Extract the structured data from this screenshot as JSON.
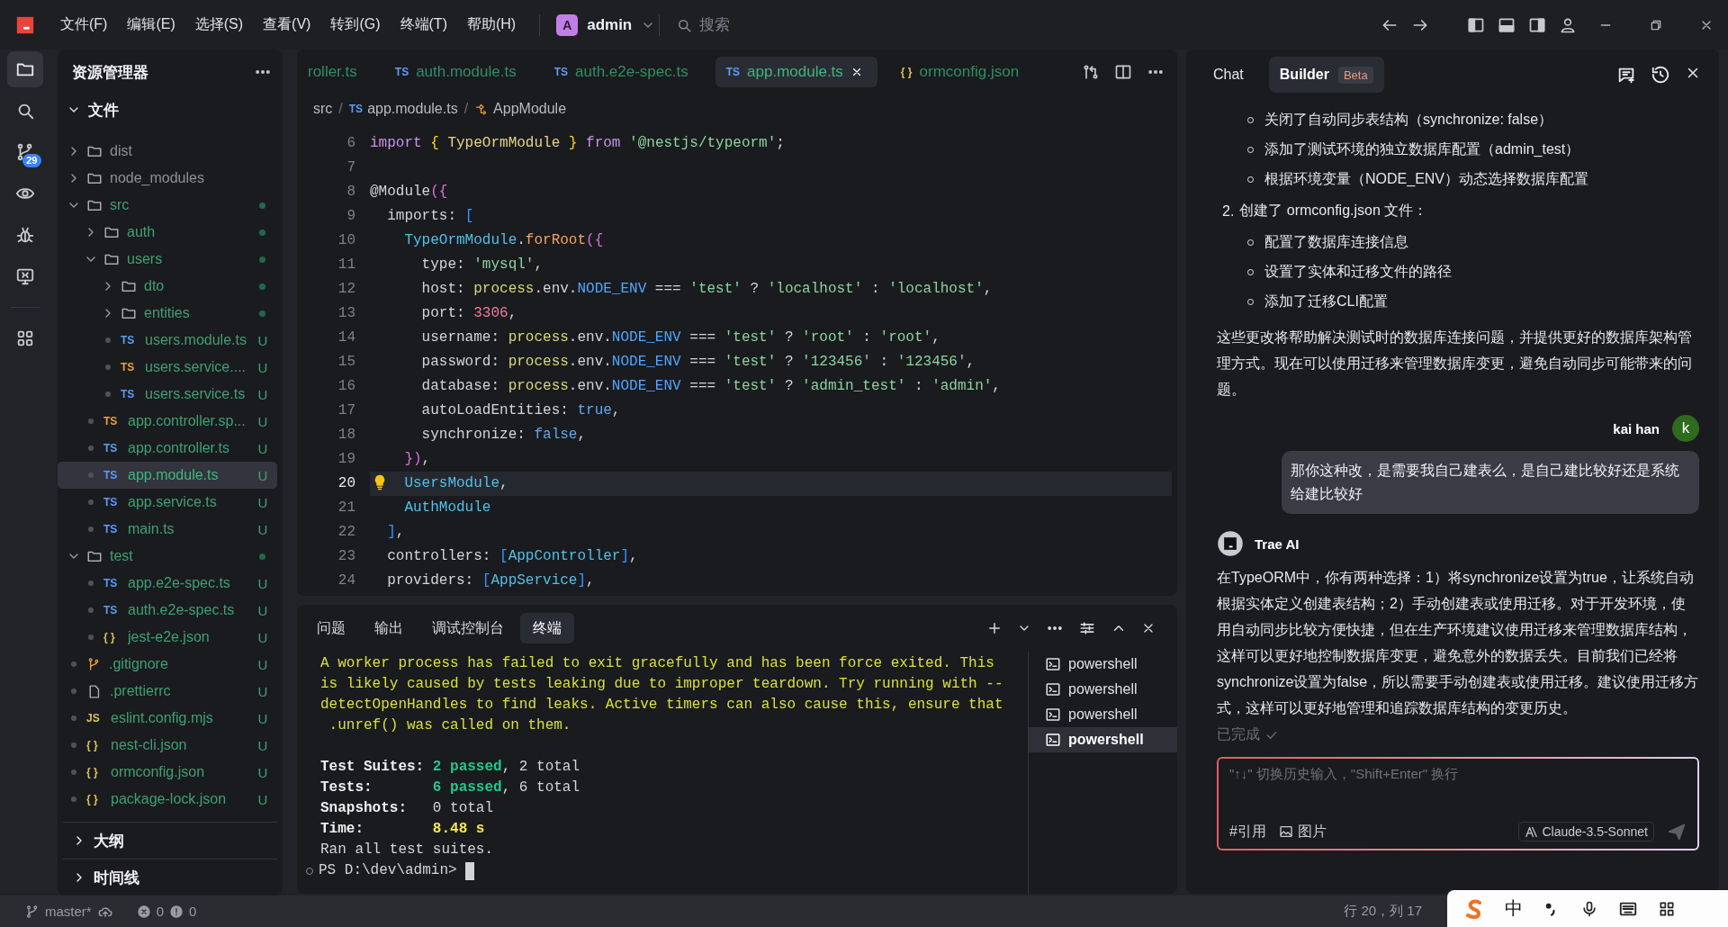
{
  "title_bar": {
    "menus": [
      "文件(F)",
      "编辑(E)",
      "选择(S)",
      "查看(V)",
      "转到(G)",
      "终端(T)",
      "帮助(H)"
    ],
    "account": {
      "initial": "A",
      "name": "admin"
    },
    "search": {
      "placeholder": "搜索"
    }
  },
  "activity_bar": {
    "items": [
      {
        "kind": "explorer",
        "selected": true
      },
      {
        "kind": "search",
        "selected": false
      },
      {
        "kind": "source_control",
        "selected": false,
        "badge": "29"
      },
      {
        "kind": "remote",
        "selected": false
      },
      {
        "kind": "debug",
        "selected": false
      },
      {
        "kind": "remote_explorer",
        "selected": false
      },
      {
        "kind": "extensions",
        "selected": false
      }
    ]
  },
  "sidebar": {
    "title": "资源管理器",
    "section": {
      "label": "文件",
      "expanded": true
    },
    "tree": [
      {
        "name": "dist",
        "kind": "folder",
        "expanded": false,
        "untracked": false,
        "changed": false,
        "selected": false
      },
      {
        "name": "node_modules",
        "kind": "folder",
        "expanded": false,
        "untracked": false,
        "changed": false,
        "selected": false
      },
      {
        "name": "src",
        "kind": "folder",
        "expanded": true,
        "untracked": true,
        "changed": true,
        "selected": false,
        "children": [
          {
            "name": "auth",
            "kind": "folder",
            "expanded": false,
            "untracked": true,
            "changed": true,
            "selected": false
          },
          {
            "name": "users",
            "kind": "folder",
            "expanded": true,
            "untracked": true,
            "changed": true,
            "selected": false,
            "children": [
              {
                "name": "dto",
                "kind": "folder",
                "expanded": false,
                "untracked": true,
                "changed": true,
                "selected": false
              },
              {
                "name": "entities",
                "kind": "folder",
                "expanded": false,
                "untracked": true,
                "changed": true,
                "selected": false
              },
              {
                "name": "users.module.ts",
                "kind": "ts",
                "badge": "TS",
                "untracked": true,
                "status": "U",
                "selected": false
              },
              {
                "name": "users.service....",
                "kind": "ts_spec",
                "badge": "TS",
                "untracked": true,
                "status": "U",
                "selected": false
              },
              {
                "name": "users.service.ts",
                "kind": "ts",
                "badge": "TS",
                "untracked": true,
                "status": "U",
                "selected": false
              }
            ]
          },
          {
            "name": "app.controller.sp...",
            "kind": "ts_spec",
            "badge": "TS",
            "untracked": true,
            "status": "U",
            "selected": false
          },
          {
            "name": "app.controller.ts",
            "kind": "ts",
            "badge": "TS",
            "untracked": true,
            "status": "U",
            "selected": false
          },
          {
            "name": "app.module.ts",
            "kind": "ts",
            "badge": "TS",
            "untracked": true,
            "status": "U",
            "selected": true
          },
          {
            "name": "app.service.ts",
            "kind": "ts",
            "badge": "TS",
            "untracked": true,
            "status": "U",
            "selected": false
          },
          {
            "name": "main.ts",
            "kind": "ts",
            "badge": "TS",
            "untracked": true,
            "status": "U",
            "selected": false
          }
        ]
      },
      {
        "name": "test",
        "kind": "folder",
        "expanded": true,
        "untracked": true,
        "changed": true,
        "selected": false,
        "children": [
          {
            "name": "app.e2e-spec.ts",
            "kind": "ts",
            "badge": "TS",
            "untracked": true,
            "status": "U",
            "selected": false
          },
          {
            "name": "auth.e2e-spec.ts",
            "kind": "ts",
            "badge": "TS",
            "untracked": true,
            "status": "U",
            "selected": false
          },
          {
            "name": "jest-e2e.json",
            "kind": "json",
            "badge": "{ }",
            "untracked": true,
            "status": "U",
            "selected": false
          }
        ]
      },
      {
        "name": ".gitignore",
        "kind": "git",
        "untracked": true,
        "status": "U",
        "selected": false
      },
      {
        "name": ".prettierrc",
        "kind": "file",
        "untracked": true,
        "status": "U",
        "selected": false
      },
      {
        "name": "eslint.config.mjs",
        "kind": "js",
        "badge": "JS",
        "untracked": true,
        "status": "U",
        "selected": false
      },
      {
        "name": "nest-cli.json",
        "kind": "json",
        "badge": "{ }",
        "untracked": true,
        "status": "U",
        "selected": false
      },
      {
        "name": "ormconfig.json",
        "kind": "json",
        "badge": "{ }",
        "untracked": true,
        "status": "U",
        "selected": false
      },
      {
        "name": "package-lock.json",
        "kind": "json",
        "badge": "{ }",
        "untracked": true,
        "status": "U",
        "selected": false
      }
    ],
    "panels": [
      {
        "label": "大纲",
        "expanded": false
      },
      {
        "label": "时间线",
        "expanded": false
      }
    ]
  },
  "editor": {
    "tabs": [
      {
        "label": "roller.ts",
        "selected": false
      },
      {
        "label": "auth.module.ts",
        "kind": "ts",
        "badge": "TS",
        "selected": false
      },
      {
        "label": "auth.e2e-spec.ts",
        "kind": "ts",
        "badge": "TS",
        "selected": false
      },
      {
        "label": "app.module.ts",
        "kind": "ts",
        "badge": "TS",
        "selected": true
      },
      {
        "label": "ormconfig.json",
        "kind": "json",
        "badge": "{ }",
        "selected": false
      }
    ],
    "breadcrumb": [
      {
        "kind": "folder",
        "text": "src"
      },
      {
        "kind": "sep",
        "text": "/"
      },
      {
        "kind": "ts",
        "badge": "TS",
        "text": "app.module.ts"
      },
      {
        "kind": "sep",
        "text": "/"
      },
      {
        "kind": "symbol",
        "text": "AppModule"
      }
    ],
    "lines": [
      {
        "number": "6",
        "current": false,
        "hint": false,
        "tokens": [
          {
            "kind": "kw",
            "text": "import"
          },
          {
            "kind": "br3",
            "text": " {"
          },
          {
            "kind": "cls",
            "text": " TypeOrmModule "
          },
          {
            "kind": "br3",
            "text": "}"
          },
          {
            "kind": "kw",
            "text": " from"
          },
          {
            "kind": "str",
            "text": " '@nestjs/typeorm'"
          },
          {
            "kind": "p",
            "text": ";"
          }
        ]
      },
      {
        "number": "7",
        "current": false,
        "hint": false
      },
      {
        "number": "8",
        "current": false,
        "hint": false,
        "tokens": [
          {
            "kind": "p",
            "text": "@Module"
          },
          {
            "kind": "br1",
            "text": "({"
          }
        ]
      },
      {
        "number": "9",
        "current": false,
        "hint": false,
        "tokens": [
          {
            "kind": "p",
            "text": "  imports: "
          },
          {
            "kind": "br2",
            "text": "["
          }
        ]
      },
      {
        "number": "10",
        "current": false,
        "hint": false,
        "tokens": [
          {
            "kind": "type",
            "text": "    TypeOrmModule"
          },
          {
            "kind": "p",
            "text": "."
          },
          {
            "kind": "fn",
            "text": "forRoot"
          },
          {
            "kind": "br1",
            "text": "({"
          }
        ]
      },
      {
        "number": "11",
        "current": false,
        "hint": false,
        "tokens": [
          {
            "kind": "p",
            "text": "      type: "
          },
          {
            "kind": "str",
            "text": "'mysql'"
          },
          {
            "kind": "p",
            "text": ","
          }
        ]
      },
      {
        "number": "12",
        "current": false,
        "hint": false,
        "tokens": [
          {
            "kind": "p",
            "text": "      host: "
          },
          {
            "kind": "var",
            "text": "process"
          },
          {
            "kind": "p",
            "text": ".env."
          },
          {
            "kind": "const",
            "text": "NODE_ENV"
          },
          {
            "kind": "p",
            "text": " === "
          },
          {
            "kind": "str",
            "text": "'test'"
          },
          {
            "kind": "p",
            "text": " ? "
          },
          {
            "kind": "str",
            "text": "'localhost'"
          },
          {
            "kind": "p",
            "text": " : "
          },
          {
            "kind": "str",
            "text": "'localhost'"
          },
          {
            "kind": "p",
            "text": ","
          }
        ]
      },
      {
        "number": "13",
        "current": false,
        "hint": false,
        "tokens": [
          {
            "kind": "p",
            "text": "      port: "
          },
          {
            "kind": "num",
            "text": "3306"
          },
          {
            "kind": "p",
            "text": ","
          }
        ]
      },
      {
        "number": "14",
        "current": false,
        "hint": false,
        "tokens": [
          {
            "kind": "p",
            "text": "      username: "
          },
          {
            "kind": "var",
            "text": "process"
          },
          {
            "kind": "p",
            "text": ".env."
          },
          {
            "kind": "const",
            "text": "NODE_ENV"
          },
          {
            "kind": "p",
            "text": " === "
          },
          {
            "kind": "str",
            "text": "'test'"
          },
          {
            "kind": "p",
            "text": " ? "
          },
          {
            "kind": "str",
            "text": "'root'"
          },
          {
            "kind": "p",
            "text": " : "
          },
          {
            "kind": "str",
            "text": "'root'"
          },
          {
            "kind": "p",
            "text": ","
          }
        ]
      },
      {
        "number": "15",
        "current": false,
        "hint": false,
        "tokens": [
          {
            "kind": "p",
            "text": "      password: "
          },
          {
            "kind": "var",
            "text": "process"
          },
          {
            "kind": "p",
            "text": ".env."
          },
          {
            "kind": "const",
            "text": "NODE_ENV"
          },
          {
            "kind": "p",
            "text": " === "
          },
          {
            "kind": "str",
            "text": "'test'"
          },
          {
            "kind": "p",
            "text": " ? "
          },
          {
            "kind": "str",
            "text": "'123456'"
          },
          {
            "kind": "p",
            "text": " : "
          },
          {
            "kind": "str",
            "text": "'123456'"
          },
          {
            "kind": "p",
            "text": ","
          }
        ]
      },
      {
        "number": "16",
        "current": false,
        "hint": false,
        "tokens": [
          {
            "kind": "p",
            "text": "      database: "
          },
          {
            "kind": "var",
            "text": "process"
          },
          {
            "kind": "p",
            "text": ".env."
          },
          {
            "kind": "const",
            "text": "NODE_ENV"
          },
          {
            "kind": "p",
            "text": " === "
          },
          {
            "kind": "str",
            "text": "'test'"
          },
          {
            "kind": "p",
            "text": " ? "
          },
          {
            "kind": "str",
            "text": "'admin_test'"
          },
          {
            "kind": "p",
            "text": " : "
          },
          {
            "kind": "str",
            "text": "'admin'"
          },
          {
            "kind": "p",
            "text": ","
          }
        ]
      },
      {
        "number": "17",
        "current": false,
        "hint": false,
        "tokens": [
          {
            "kind": "p",
            "text": "      autoLoadEntities: "
          },
          {
            "kind": "bool",
            "text": "true"
          },
          {
            "kind": "p",
            "text": ","
          }
        ]
      },
      {
        "number": "18",
        "current": false,
        "hint": false,
        "tokens": [
          {
            "kind": "p",
            "text": "      synchronize: "
          },
          {
            "kind": "bool",
            "text": "false"
          },
          {
            "kind": "p",
            "text": ","
          }
        ]
      },
      {
        "number": "19",
        "current": false,
        "hint": false,
        "tokens": [
          {
            "kind": "br1",
            "text": "    })"
          },
          {
            "kind": "p",
            "text": ","
          }
        ]
      },
      {
        "number": "20",
        "current": true,
        "hint": true,
        "tokens": [
          {
            "kind": "type",
            "text": "    UsersModule"
          },
          {
            "kind": "p",
            "text": ","
          }
        ]
      },
      {
        "number": "21",
        "current": false,
        "hint": false,
        "tokens": [
          {
            "kind": "type",
            "text": "    AuthModule"
          }
        ]
      },
      {
        "number": "22",
        "current": false,
        "hint": false,
        "tokens": [
          {
            "kind": "br2",
            "text": "  ]"
          },
          {
            "kind": "p",
            "text": ","
          }
        ]
      },
      {
        "number": "23",
        "current": false,
        "hint": false,
        "tokens": [
          {
            "kind": "p",
            "text": "  controllers: "
          },
          {
            "kind": "br2",
            "text": "["
          },
          {
            "kind": "type",
            "text": "AppController"
          },
          {
            "kind": "br2",
            "text": "]"
          },
          {
            "kind": "p",
            "text": ","
          }
        ]
      },
      {
        "number": "24",
        "current": false,
        "hint": false,
        "tokens": [
          {
            "kind": "p",
            "text": "  providers: "
          },
          {
            "kind": "br2",
            "text": "["
          },
          {
            "kind": "type",
            "text": "AppService"
          },
          {
            "kind": "br2",
            "text": "]"
          },
          {
            "kind": "p",
            "text": ","
          }
        ]
      }
    ]
  },
  "panel": {
    "tabs": [
      {
        "label": "问题",
        "selected": false
      },
      {
        "label": "输出",
        "selected": false
      },
      {
        "label": "调试控制台",
        "selected": false
      },
      {
        "label": "终端",
        "selected": true
      }
    ],
    "lines": [
      {
        "kind": "text",
        "tokens": [
          {
            "kind": "warn",
            "text": "A worker process has failed to exit gracefully and has been force exited. This"
          }
        ]
      },
      {
        "kind": "text",
        "tokens": [
          {
            "kind": "warn",
            "text": "is likely caused by tests leaking due to improper teardown. Try running with --"
          }
        ]
      },
      {
        "kind": "text",
        "tokens": [
          {
            "kind": "warn",
            "text": "detectOpenHandles to find leaks. Active timers can also cause this, ensure that"
          }
        ]
      },
      {
        "kind": "text",
        "tokens": [
          {
            "kind": "warn",
            "text": " .unref() was called on them."
          }
        ]
      },
      {
        "kind": "blank"
      },
      {
        "kind": "text",
        "tokens": [
          {
            "kind": "bold",
            "text": "Test Suites: "
          },
          {
            "kind": "pass",
            "text": "2 passed"
          },
          {
            "kind": "plain",
            "text": ", 2 total"
          }
        ]
      },
      {
        "kind": "text",
        "tokens": [
          {
            "kind": "bold",
            "text": "Tests:       "
          },
          {
            "kind": "pass",
            "text": "6 passed"
          },
          {
            "kind": "plain",
            "text": ", 6 total"
          }
        ]
      },
      {
        "kind": "text",
        "tokens": [
          {
            "kind": "bold",
            "text": "Snapshots:   "
          },
          {
            "kind": "plain",
            "text": "0 total"
          }
        ]
      },
      {
        "kind": "text",
        "tokens": [
          {
            "kind": "bold",
            "text": "Time:        "
          },
          {
            "kind": "time",
            "text": "8.48 s"
          }
        ]
      },
      {
        "kind": "text",
        "tokens": [
          {
            "kind": "plain",
            "text": "Ran all test suites."
          }
        ]
      }
    ],
    "prompt": "PS D:\\dev\\admin> ",
    "sessions": [
      {
        "label": "powershell",
        "selected": false
      },
      {
        "label": "powershell",
        "selected": false
      },
      {
        "label": "powershell",
        "selected": false
      },
      {
        "label": "powershell",
        "selected": true
      }
    ]
  },
  "chat": {
    "tabs": [
      {
        "label": "Chat",
        "selected": false
      },
      {
        "label": "Builder",
        "selected": true,
        "badge": "Beta"
      }
    ],
    "messages": [
      {
        "kind": "ai_continued",
        "blocks": [
          {
            "kind": "bullets",
            "items": [
              "关闭了自动同步表结构（synchronize: false）",
              "添加了测试环境的独立数据库配置（admin_test）",
              "根据环境变量（NODE_ENV）动态选择数据库配置"
            ]
          },
          {
            "kind": "numbered",
            "marker": "2.",
            "text": "创建了 ormconfig.json 文件：",
            "items": [
              "配置了数据库连接信息",
              "设置了实体和迁移文件的路径",
              "添加了迁移CLI配置"
            ]
          },
          {
            "kind": "paragraph",
            "text": "这些更改将帮助解决测试时的数据库连接问题，并提供更好的数据库架构管理方式。现在可以使用迁移来管理数据库变更，避免自动同步可能带来的问题。"
          }
        ]
      },
      {
        "kind": "user",
        "author": "kai han",
        "initial": "k",
        "text": "那你这种改，是需要我自己建表么，是自己建比较好还是系统给建比较好"
      },
      {
        "kind": "ai",
        "author": "Trae AI",
        "text": "在TypeORM中，你有两种选择：1）将synchronize设置为true，让系统自动根据实体定义创建表结构；2）手动创建表或使用迁移。对于开发环境，使用自动同步比较方便快捷，但在生产环境建议使用迁移来管理数据库结构，这样可以更好地控制数据库变更，避免意外的数据丢失。目前我们已经将synchronize设置为false，所以需要手动创建表或使用迁移。建议使用迁移方式，这样可以更好地管理和追踪数据库结构的变更历史。",
        "status": "已完成"
      }
    ],
    "input": {
      "placeholder": "\"↑↓\" 切换历史输入，\"Shift+Enter\" 换行",
      "actions": [
        {
          "kind": "reference",
          "label": "#引用"
        },
        {
          "kind": "image",
          "label": "图片"
        }
      ],
      "model": "Claude-3.5-Sonnet"
    }
  },
  "status_bar": {
    "branch": "master*",
    "errors": "0",
    "warnings": "0",
    "cursor": "行 20，列 17"
  },
  "ime_bar": {
    "mode": "中"
  }
}
